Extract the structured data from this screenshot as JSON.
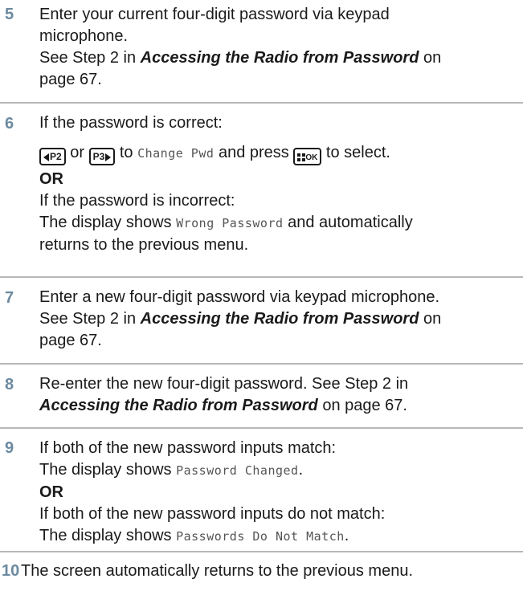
{
  "steps": [
    {
      "number": "5",
      "line1": "Enter your current four-digit password via keypad",
      "line2": "microphone.",
      "ref_prefix": "See Step 2 in ",
      "ref_title": "Accessing the Radio from Password",
      "ref_on": " on",
      "ref_page": "page 67."
    },
    {
      "number": "6",
      "line1": "If the password is correct:",
      "key_p2": "P2",
      "or_word": " or ",
      "key_p3": "P3",
      "to_text": " to ",
      "menu_item": "Change Pwd",
      "and_press": " and press ",
      "key_ok": "OK",
      "to_select": " to select.",
      "or_label": "OR",
      "incorrect_line": "If the password is incorrect:",
      "display_prefix": "The display shows ",
      "display_msg": "Wrong Password",
      "display_suffix": " and automatically",
      "return_line": "returns to the previous menu."
    },
    {
      "number": "7",
      "line1": "Enter a new four-digit password via keypad microphone.",
      "ref_prefix": "See Step 2 in ",
      "ref_title": "Accessing the Radio from Password",
      "ref_on": " on",
      "ref_page": "page 67."
    },
    {
      "number": "8",
      "line1": "Re-enter the new four-digit password. See Step 2 in",
      "ref_title": "Accessing the Radio from Password",
      "ref_suffix": " on page 67."
    },
    {
      "number": "9",
      "line1": "If both of the new password inputs match:",
      "display_prefix": "The display shows ",
      "match_msg": "Password Changed",
      "period": ".",
      "or_label": "OR",
      "nomatch_line": "If both of the new password inputs do not match:",
      "display_prefix2": "The display shows ",
      "nomatch_msg": "Passwords Do Not Match",
      "period2": "."
    },
    {
      "number": "10",
      "line1": "The screen automatically returns to the previous menu."
    }
  ]
}
